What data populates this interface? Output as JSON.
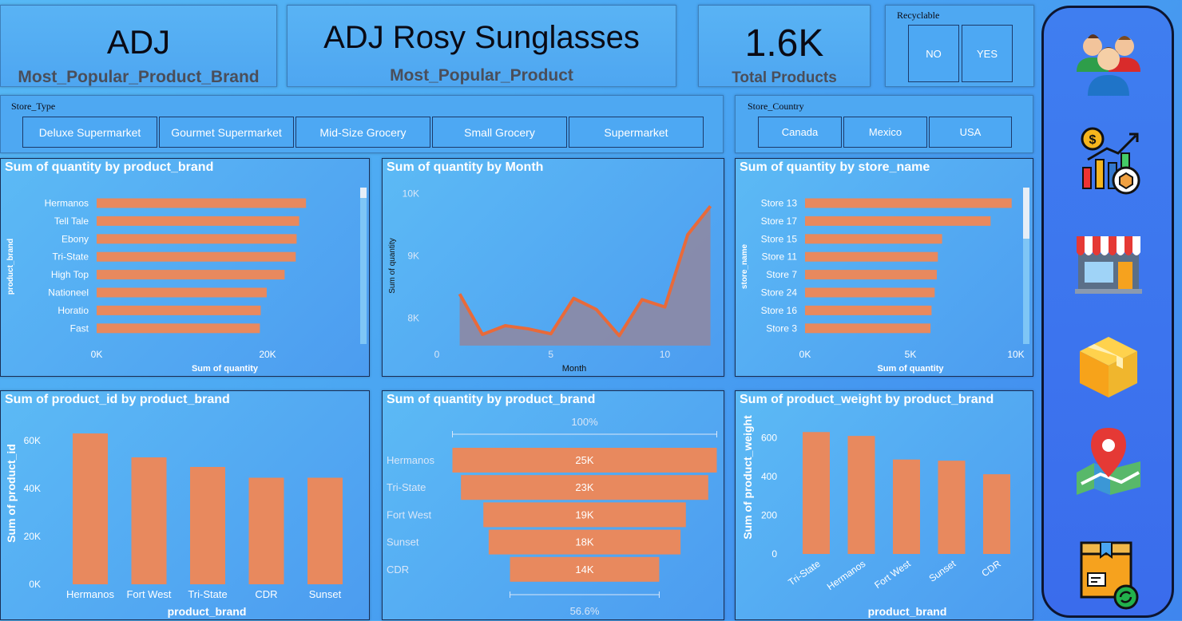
{
  "kpis": {
    "brand": {
      "value": "ADJ",
      "label": "Most_Popular_Product_Brand"
    },
    "product": {
      "value": "ADJ Rosy Sunglasses",
      "label": "Most_Popular_Product"
    },
    "total": {
      "value": "1.6K",
      "label": "Total Products"
    }
  },
  "recyclable": {
    "title": "Recyclable",
    "options": [
      "NO",
      "YES"
    ]
  },
  "store_type": {
    "title": "Store_Type",
    "options": [
      "Deluxe Supermarket",
      "Gourmet Supermarket",
      "Mid-Size Grocery",
      "Small Grocery",
      "Supermarket"
    ]
  },
  "store_country": {
    "title": "Store_Country",
    "options": [
      "Canada",
      "Mexico",
      "USA"
    ]
  },
  "nav_icons": [
    "users-icon",
    "sales-chart-icon",
    "store-icon",
    "product-box-icon",
    "map-pin-icon",
    "delivery-box-icon"
  ],
  "chart_data": [
    {
      "id": "qty_by_brand",
      "type": "bar",
      "orientation": "horizontal",
      "title": "Sum of quantity by product_brand",
      "xlabel": "Sum of quantity",
      "ylabel": "product_brand",
      "categories": [
        "Hermanos",
        "Tell Tale",
        "Ebony",
        "Tri-State",
        "High Top",
        "Nationeel",
        "Horatio",
        "Fast"
      ],
      "values": [
        24500,
        23700,
        23400,
        23300,
        22000,
        19900,
        19200,
        19100
      ],
      "xlim": [
        0,
        30000
      ],
      "ticks": [
        {
          "v": 0,
          "label": "0K"
        },
        {
          "v": 20000,
          "label": "20K"
        }
      ],
      "color": "#e8895e"
    },
    {
      "id": "qty_by_month",
      "type": "area",
      "title": "Sum of quantity by Month",
      "xlabel": "Month",
      "ylabel": "Sum of quantity",
      "x": [
        1,
        2,
        3,
        4,
        5,
        6,
        7,
        8,
        9,
        10,
        11,
        12
      ],
      "values": [
        8390,
        7740,
        7880,
        7830,
        7750,
        8320,
        8140,
        7720,
        8300,
        8180,
        9340,
        9800
      ],
      "xlim": [
        0,
        12.4
      ],
      "ylim": [
        7560,
        10150
      ],
      "xticks": [
        {
          "v": 0,
          "label": "0"
        },
        {
          "v": 5,
          "label": "5"
        },
        {
          "v": 10,
          "label": "10"
        }
      ],
      "yticks": [
        {
          "v": 8000,
          "label": "8K"
        },
        {
          "v": 9000,
          "label": "9K"
        },
        {
          "v": 10000,
          "label": "10K"
        }
      ],
      "line_color": "#e86a3a",
      "fill_color": "#8a8aa8"
    },
    {
      "id": "qty_by_store",
      "type": "bar",
      "orientation": "horizontal",
      "title": "Sum of quantity by store_name",
      "xlabel": "Sum of quantity",
      "ylabel": "store_name",
      "categories": [
        "Store 13",
        "Store 17",
        "Store 15",
        "Store 11",
        "Store 7",
        "Store 24",
        "Store 16",
        "Store 3"
      ],
      "values": [
        9800,
        8800,
        6500,
        6300,
        6250,
        6150,
        6000,
        5950
      ],
      "xlim": [
        0,
        10000
      ],
      "ticks": [
        {
          "v": 0,
          "label": "0K"
        },
        {
          "v": 5000,
          "label": "5K"
        },
        {
          "v": 10000,
          "label": "10K"
        }
      ],
      "color": "#e8895e"
    },
    {
      "id": "pid_by_brand",
      "type": "bar",
      "orientation": "vertical",
      "title": "Sum of product_id by product_brand",
      "xlabel": "product_brand",
      "ylabel": "Sum of product_id",
      "categories": [
        "Hermanos",
        "Fort West",
        "Tri-State",
        "CDR",
        "Sunset"
      ],
      "values": [
        63000,
        53000,
        49000,
        44500,
        44500
      ],
      "ylim": [
        0,
        66000
      ],
      "ticks": [
        {
          "v": 0,
          "label": "0K"
        },
        {
          "v": 20000,
          "label": "20K"
        },
        {
          "v": 40000,
          "label": "40K"
        },
        {
          "v": 60000,
          "label": "60K"
        }
      ],
      "color": "#e8895e"
    },
    {
      "id": "qty_funnel",
      "type": "bar",
      "orientation": "funnel",
      "title": "Sum of quantity by product_brand",
      "categories": [
        "Hermanos",
        "Tri-State",
        "Fort West",
        "Sunset",
        "CDR"
      ],
      "values": [
        24800,
        23200,
        19000,
        18000,
        14000
      ],
      "labels": [
        "25K",
        "23K",
        "19K",
        "18K",
        "14K"
      ],
      "top_pct": "100%",
      "bottom_pct": "56.6%",
      "color": "#e8895e"
    },
    {
      "id": "weight_by_brand",
      "type": "bar",
      "orientation": "vertical",
      "title": "Sum of product_weight by product_brand",
      "xlabel": "product_brand",
      "ylabel": "Sum of product_weight",
      "categories": [
        "Tri-State",
        "Hermanos",
        "Fort West",
        "Sunset",
        "CDR"
      ],
      "values": [
        630,
        610,
        488,
        482,
        412
      ],
      "ylim": [
        0,
        660
      ],
      "ticks": [
        {
          "v": 0,
          "label": "0"
        },
        {
          "v": 200,
          "label": "200"
        },
        {
          "v": 400,
          "label": "400"
        },
        {
          "v": 600,
          "label": "600"
        }
      ],
      "color": "#e8895e"
    }
  ]
}
